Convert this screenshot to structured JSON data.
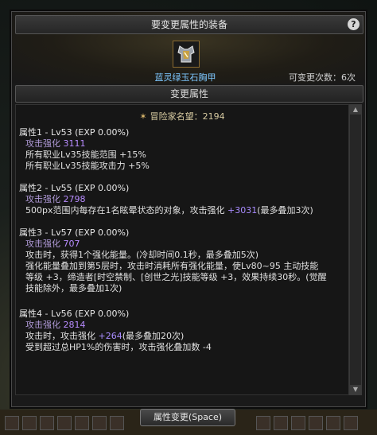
{
  "panel": {
    "title": "要变更属性的装备",
    "help_label": "?",
    "item_name": "蓝灵绿玉石胸甲",
    "changes_remaining": "可变更次数：6次",
    "section_title": "变更属性"
  },
  "reputation": "冒险家名望：2194",
  "attributes": [
    {
      "header": "属性1 - Lv53 (EXP 0.00%)",
      "atk_label": "攻击强化",
      "atk_value": "3111",
      "lines": [
        "所有职业Lv35技能范围 +15%",
        "所有职业Lv35技能攻击力 +5%"
      ]
    },
    {
      "header": "属性2 - Lv55 (EXP 0.00%)",
      "atk_label": "攻击强化",
      "atk_value": "2798",
      "lines_pre": [
        "500px范围内每存在1名眩晕状态的对象，攻击强化 "
      ],
      "line_hl": "+3031",
      "line_post": "(最多叠加3次)"
    },
    {
      "header": "属性3 - Lv57 (EXP 0.00%)",
      "atk_label": "攻击强化",
      "atk_value": "707",
      "lines": [
        "攻击时，获得1个强化能量。(冷却时间0.1秒，最多叠加5次)",
        "强化能量叠加到第5层时，攻击时消耗所有强化能量，使Lv80~95 主动技能",
        "等级 +3，缔造者[时空禁制、[创世之光]技能等级 +3，效果持续30秒。(觉醒",
        "技能除外，最多叠加1次)"
      ]
    },
    {
      "header": "属性4 - Lv56 (EXP 0.00%)",
      "atk_label": "攻击强化",
      "atk_value": "2814",
      "line1_pre": "攻击时，攻击强化 ",
      "line1_hl": "+264",
      "line1_post": "(最多叠加20次)",
      "line2": "受到超过总HP1%的伤害时，攻击强化叠加数 -4"
    }
  ],
  "footer": {
    "button_label": "属性变更(Space)"
  },
  "colors": {
    "item_name": "#7ec8ff",
    "highlight": "#a98cff",
    "title_bar": "#2e2e2e"
  }
}
